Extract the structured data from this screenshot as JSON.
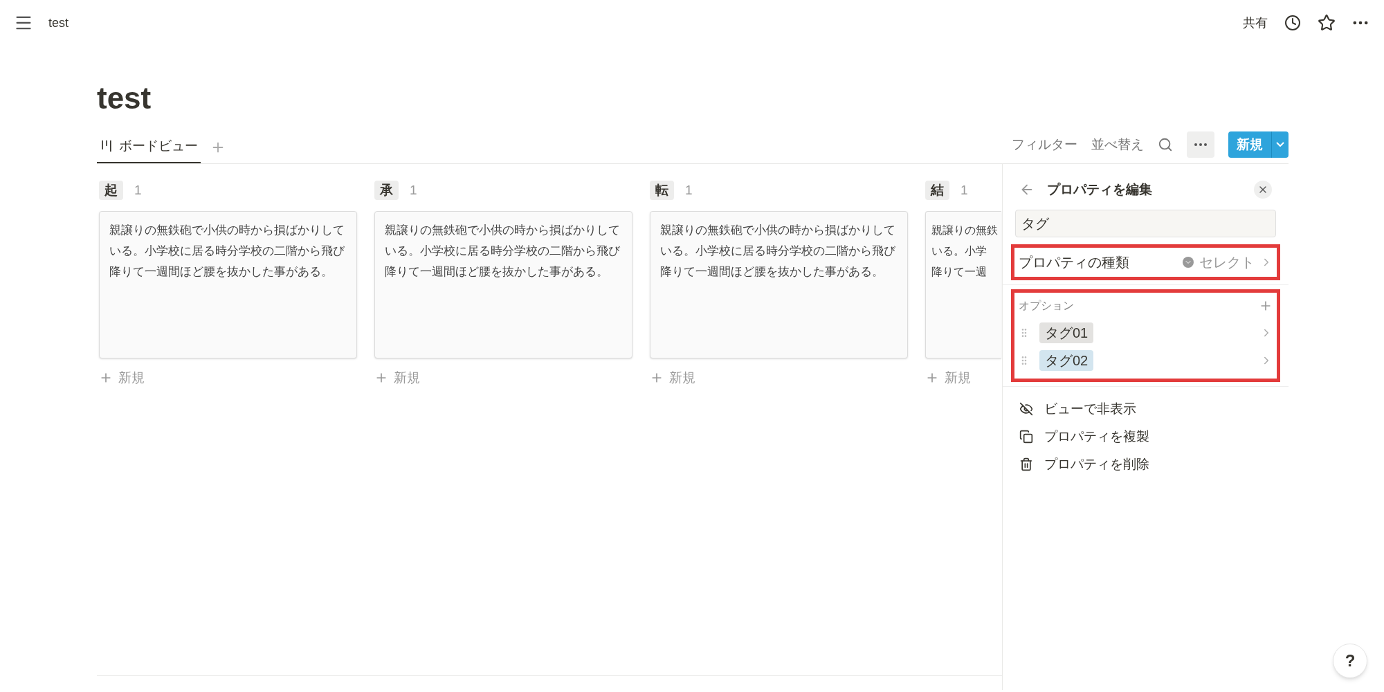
{
  "topbar": {
    "page": "test",
    "share": "共有"
  },
  "title": "test",
  "views": [
    {
      "label": "ボードビュー",
      "selected": true
    }
  ],
  "toolbar": {
    "filter": "フィルター",
    "sort": "並べ替え",
    "new": "新規"
  },
  "columns": [
    {
      "name": "起",
      "count": "1",
      "card_lines": [
        "親譲りの無鉄砲で小供の時から損ばかりして",
        "いる。小学校に居る時分学校の二階から飛び",
        "降りて一週間ほど腰を抜かした事がある。"
      ],
      "add": "新規"
    },
    {
      "name": "承",
      "count": "1",
      "card_lines": [
        "親譲りの無鉄砲で小供の時から損ばかりして",
        "いる。小学校に居る時分学校の二階から飛び",
        "降りて一週間ほど腰を抜かした事がある。"
      ],
      "add": "新規"
    },
    {
      "name": "転",
      "count": "1",
      "card_lines": [
        "親譲りの無鉄砲で小供の時から損ばかりして",
        "いる。小学校に居る時分学校の二階から飛び",
        "降りて一週間ほど腰を抜かした事がある。"
      ],
      "add": "新規"
    },
    {
      "name": "結",
      "count": "1",
      "card_lines": [
        "親譲りの無鉄",
        "いる。小学",
        "降りて一週"
      ],
      "add": "新規"
    }
  ],
  "panel": {
    "title": "プロパティを編集",
    "name_value": "タグ",
    "type_row": {
      "label": "プロパティの種類",
      "value": "セレクト",
      "highlighted": true
    },
    "options": {
      "label": "オプション",
      "highlighted": true,
      "items": [
        {
          "label": "タグ01",
          "color": "#e3e2e0"
        },
        {
          "label": "タグ02",
          "color": "#d3e5ef"
        }
      ]
    },
    "actions": [
      {
        "kind": "hide",
        "label": "ビューで非表示"
      },
      {
        "kind": "duplicate",
        "label": "プロパティを複製"
      },
      {
        "kind": "delete",
        "label": "プロパティを削除"
      }
    ]
  },
  "help": "?"
}
